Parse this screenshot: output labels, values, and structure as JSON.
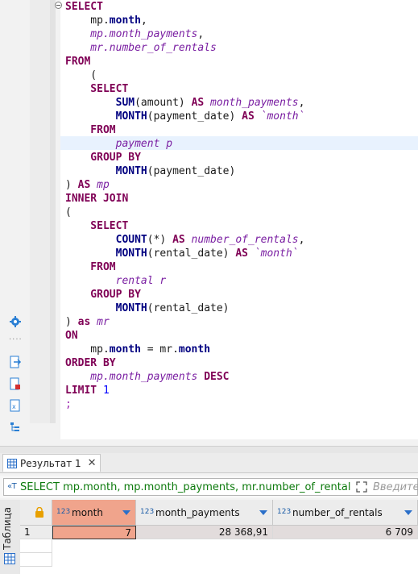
{
  "editor": {
    "lines": [
      [
        {
          "t": "SELECT",
          "c": "kw"
        }
      ],
      [
        {
          "t": "    mp.",
          "c": "pl"
        },
        {
          "t": "month",
          "c": "fn"
        },
        {
          "t": ",",
          "c": "pl"
        }
      ],
      [
        {
          "t": "    mp.month_payments",
          "c": "al"
        },
        {
          "t": ",",
          "c": "pl"
        }
      ],
      [
        {
          "t": "    mr.number_of_rentals",
          "c": "al"
        }
      ],
      [
        {
          "t": "FROM",
          "c": "kw"
        }
      ],
      [
        {
          "t": "    (",
          "c": "pl"
        }
      ],
      [
        {
          "t": "    SELECT",
          "c": "kw"
        }
      ],
      [
        {
          "t": "        ",
          "c": "pl"
        },
        {
          "t": "SUM",
          "c": "fn"
        },
        {
          "t": "(amount) ",
          "c": "pl"
        },
        {
          "t": "AS",
          "c": "kw"
        },
        {
          "t": " month_payments",
          "c": "al"
        },
        {
          "t": ",",
          "c": "pl"
        }
      ],
      [
        {
          "t": "        ",
          "c": "pl"
        },
        {
          "t": "MONTH",
          "c": "fn"
        },
        {
          "t": "(payment_date) ",
          "c": "pl"
        },
        {
          "t": "AS",
          "c": "kw"
        },
        {
          "t": " `month`",
          "c": "tick"
        }
      ],
      [
        {
          "t": "    FROM",
          "c": "kw"
        }
      ],
      [
        {
          "t": "        payment p",
          "c": "al"
        }
      ],
      [
        {
          "t": "    GROUP BY",
          "c": "kw"
        }
      ],
      [
        {
          "t": "        ",
          "c": "pl"
        },
        {
          "t": "MONTH",
          "c": "fn"
        },
        {
          "t": "(payment_date)",
          "c": "pl"
        }
      ],
      [
        {
          "t": ") ",
          "c": "pl"
        },
        {
          "t": "AS",
          "c": "kw"
        },
        {
          "t": " mp",
          "c": "al"
        }
      ],
      [
        {
          "t": "INNER JOIN",
          "c": "kw"
        }
      ],
      [
        {
          "t": "(",
          "c": "pl"
        }
      ],
      [
        {
          "t": "    SELECT",
          "c": "kw"
        }
      ],
      [
        {
          "t": "        ",
          "c": "pl"
        },
        {
          "t": "COUNT",
          "c": "fn"
        },
        {
          "t": "(*) ",
          "c": "pl"
        },
        {
          "t": "AS",
          "c": "kw"
        },
        {
          "t": " number_of_rentals",
          "c": "al"
        },
        {
          "t": ",",
          "c": "pl"
        }
      ],
      [
        {
          "t": "        ",
          "c": "pl"
        },
        {
          "t": "MONTH",
          "c": "fn"
        },
        {
          "t": "(rental_date) ",
          "c": "pl"
        },
        {
          "t": "AS",
          "c": "kw"
        },
        {
          "t": " `month`",
          "c": "tick"
        }
      ],
      [
        {
          "t": "    FROM",
          "c": "kw"
        }
      ],
      [
        {
          "t": "        rental r",
          "c": "al"
        }
      ],
      [
        {
          "t": "    GROUP BY",
          "c": "kw"
        }
      ],
      [
        {
          "t": "        ",
          "c": "pl"
        },
        {
          "t": "MONTH",
          "c": "fn"
        },
        {
          "t": "(rental_date)",
          "c": "pl"
        }
      ],
      [
        {
          "t": ") ",
          "c": "pl"
        },
        {
          "t": "as",
          "c": "kw"
        },
        {
          "t": " mr",
          "c": "al"
        }
      ],
      [
        {
          "t": "ON",
          "c": "kw"
        }
      ],
      [
        {
          "t": "    mp.",
          "c": "pl"
        },
        {
          "t": "month",
          "c": "fn"
        },
        {
          "t": " = mr.",
          "c": "pl"
        },
        {
          "t": "month",
          "c": "fn"
        }
      ],
      [
        {
          "t": "ORDER BY",
          "c": "kw"
        }
      ],
      [
        {
          "t": "    mp.month_payments",
          "c": "al"
        },
        {
          "t": " ",
          "c": "pl"
        },
        {
          "t": "DESC",
          "c": "kw"
        }
      ],
      [
        {
          "t": "LIMIT ",
          "c": "kw"
        },
        {
          "t": "1",
          "c": "num"
        }
      ],
      [
        {
          "t": ";",
          "c": "semi"
        }
      ]
    ]
  },
  "results": {
    "tab_label": "Результат 1",
    "tab_close": "✕",
    "filter_prefix": "«T",
    "filter_text": "SELECT mp.month, mp.month_payments, mr.number_of_rentals",
    "filter_placeholder": "Введите",
    "side_label": "Таблица",
    "columns": [
      {
        "type": "123",
        "name": "month"
      },
      {
        "type": "123",
        "name": "month_payments"
      },
      {
        "type": "123",
        "name": "number_of_rentals"
      }
    ],
    "rows": [
      {
        "num": "1",
        "month": "7",
        "month_payments": "28 368,91",
        "number_of_rentals": "6 709"
      }
    ]
  },
  "colors": {
    "keyword": "#7f0055",
    "function": "#000080",
    "alias": "#7a1fa2",
    "selected_header": "#f0a48c",
    "filter_text": "#0c7a0c"
  }
}
